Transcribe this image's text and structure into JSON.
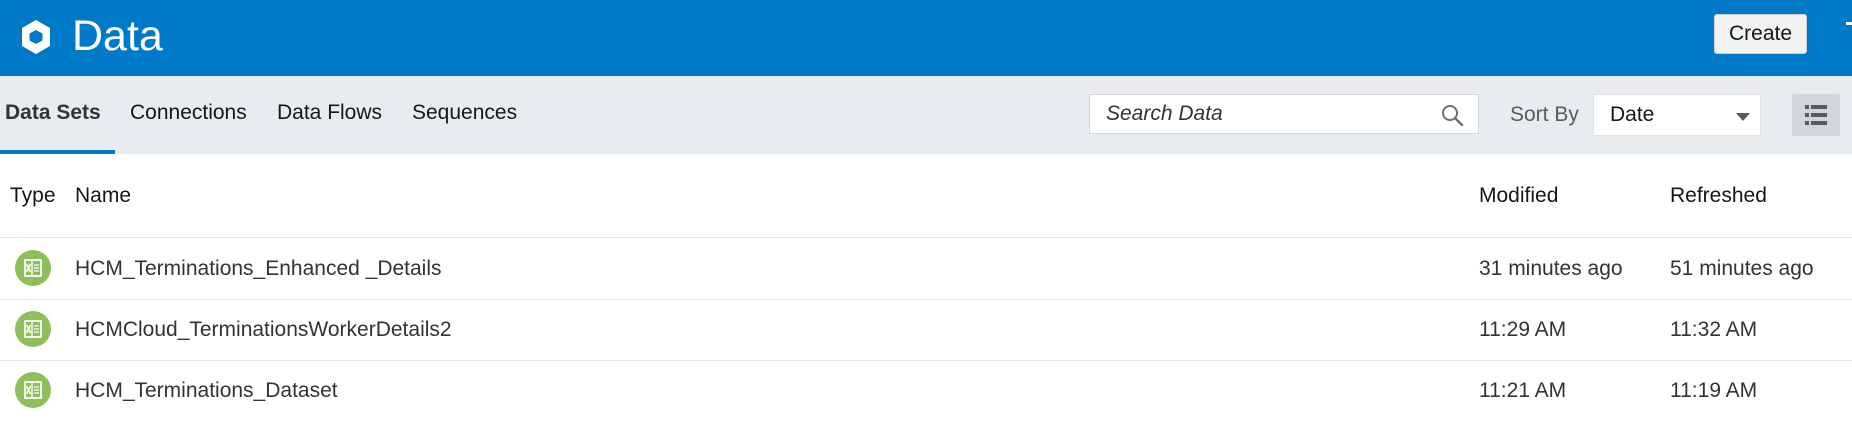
{
  "header": {
    "title": "Data",
    "create_label": "Create",
    "logo_icon": "hexagon-logo-icon",
    "background_color": "#0079c8"
  },
  "tabs": [
    {
      "label": "Data Sets",
      "active": true
    },
    {
      "label": "Connections",
      "active": false
    },
    {
      "label": "Data Flows",
      "active": false
    },
    {
      "label": "Sequences",
      "active": false
    }
  ],
  "search": {
    "placeholder": "Search Data",
    "value": "",
    "icon": "search-icon"
  },
  "sort": {
    "label": "Sort By",
    "selected": "Date",
    "icon": "chevron-down-icon"
  },
  "view_toggle": {
    "icon": "list-view-icon"
  },
  "table": {
    "columns": [
      "Type",
      "Name",
      "Modified",
      "Refreshed"
    ],
    "rows": [
      {
        "type_icon": "excel-file-icon",
        "name": "HCM_Terminations_Enhanced _Details",
        "modified": "31 minutes ago",
        "refreshed": "51 minutes ago"
      },
      {
        "type_icon": "excel-file-icon",
        "name": "HCMCloud_TerminationsWorkerDetails2",
        "modified": "11:29 AM",
        "refreshed": "11:32 AM"
      },
      {
        "type_icon": "excel-file-icon",
        "name": "HCM_Terminations_Dataset",
        "modified": "11:21 AM",
        "refreshed": "11:19 AM"
      }
    ]
  },
  "colors": {
    "accent": "#0079c8",
    "toolbar_bg": "#e9ecee",
    "file_icon": "#8fbf5a"
  }
}
